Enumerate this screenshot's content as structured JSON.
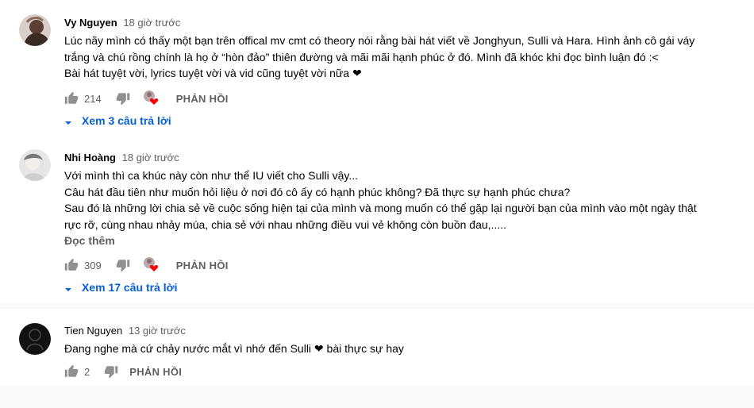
{
  "comments": [
    {
      "author": "Vy Nguyen",
      "time": "18 giờ trước",
      "lines": [
        "Lúc nãy mình có thấy một bạn trên offical mv cmt có theory nói rằng bài hát viết về Jonghyun, Sulli và Hara. Hình ảnh cô gái váy",
        "trắng và chú rồng chính là họ ở “hòn đảo” thiên đường và mãi mãi hạnh phúc ở đó. Mình đã khóc khi đọc bình luận đó :<",
        "Bài hát tuyệt vời, lyrics tuyệt vời và vid cũng tuyệt vời nữa ❤"
      ],
      "likes": "214",
      "reply_label": "PHẢN HỒI",
      "view_replies": "Xem 3 câu trả lời"
    },
    {
      "author": "Nhi Hoàng",
      "time": "18 giờ trước",
      "lines": [
        "Với mình thì ca khúc này còn như thể IU viết cho Sulli vậy...",
        "Câu hát đầu tiên như muốn hỏi liệu ở nơi đó cô ấy có hạnh phúc không? Đã thực sự hạnh phúc chưa?",
        "Sau đó là những lời chia sẻ về cuộc sống hiện tại của mình và mong muốn có thể gặp lại người bạn của mình vào một ngày thật",
        "rực rỡ, cùng nhau nhảy múa, chia sẻ với nhau những điều vui vẻ không còn buồn đau,....."
      ],
      "read_more": "Đọc thêm",
      "likes": "309",
      "reply_label": "PHẢN HỒI",
      "view_replies": "Xem 17 câu trả lời"
    },
    {
      "author": "Tien Nguyen",
      "time": "13 giờ trước",
      "lines": [
        "Đang nghe mà cứ chảy nước mắt vì nhớ đến Sulli ❤ bài thực sự hay"
      ],
      "likes": "2",
      "reply_label": "PHẢN HỒI"
    }
  ],
  "icons": {
    "like": "thumb-up-icon",
    "dislike": "thumb-down-icon",
    "creator_heart": "creator-heart-icon",
    "expand": "caret-down-icon"
  },
  "colors": {
    "link_blue": "#065fd4",
    "muted_text": "#606060",
    "heart_red": "#ff0000",
    "divider": "#f9f9f9"
  }
}
